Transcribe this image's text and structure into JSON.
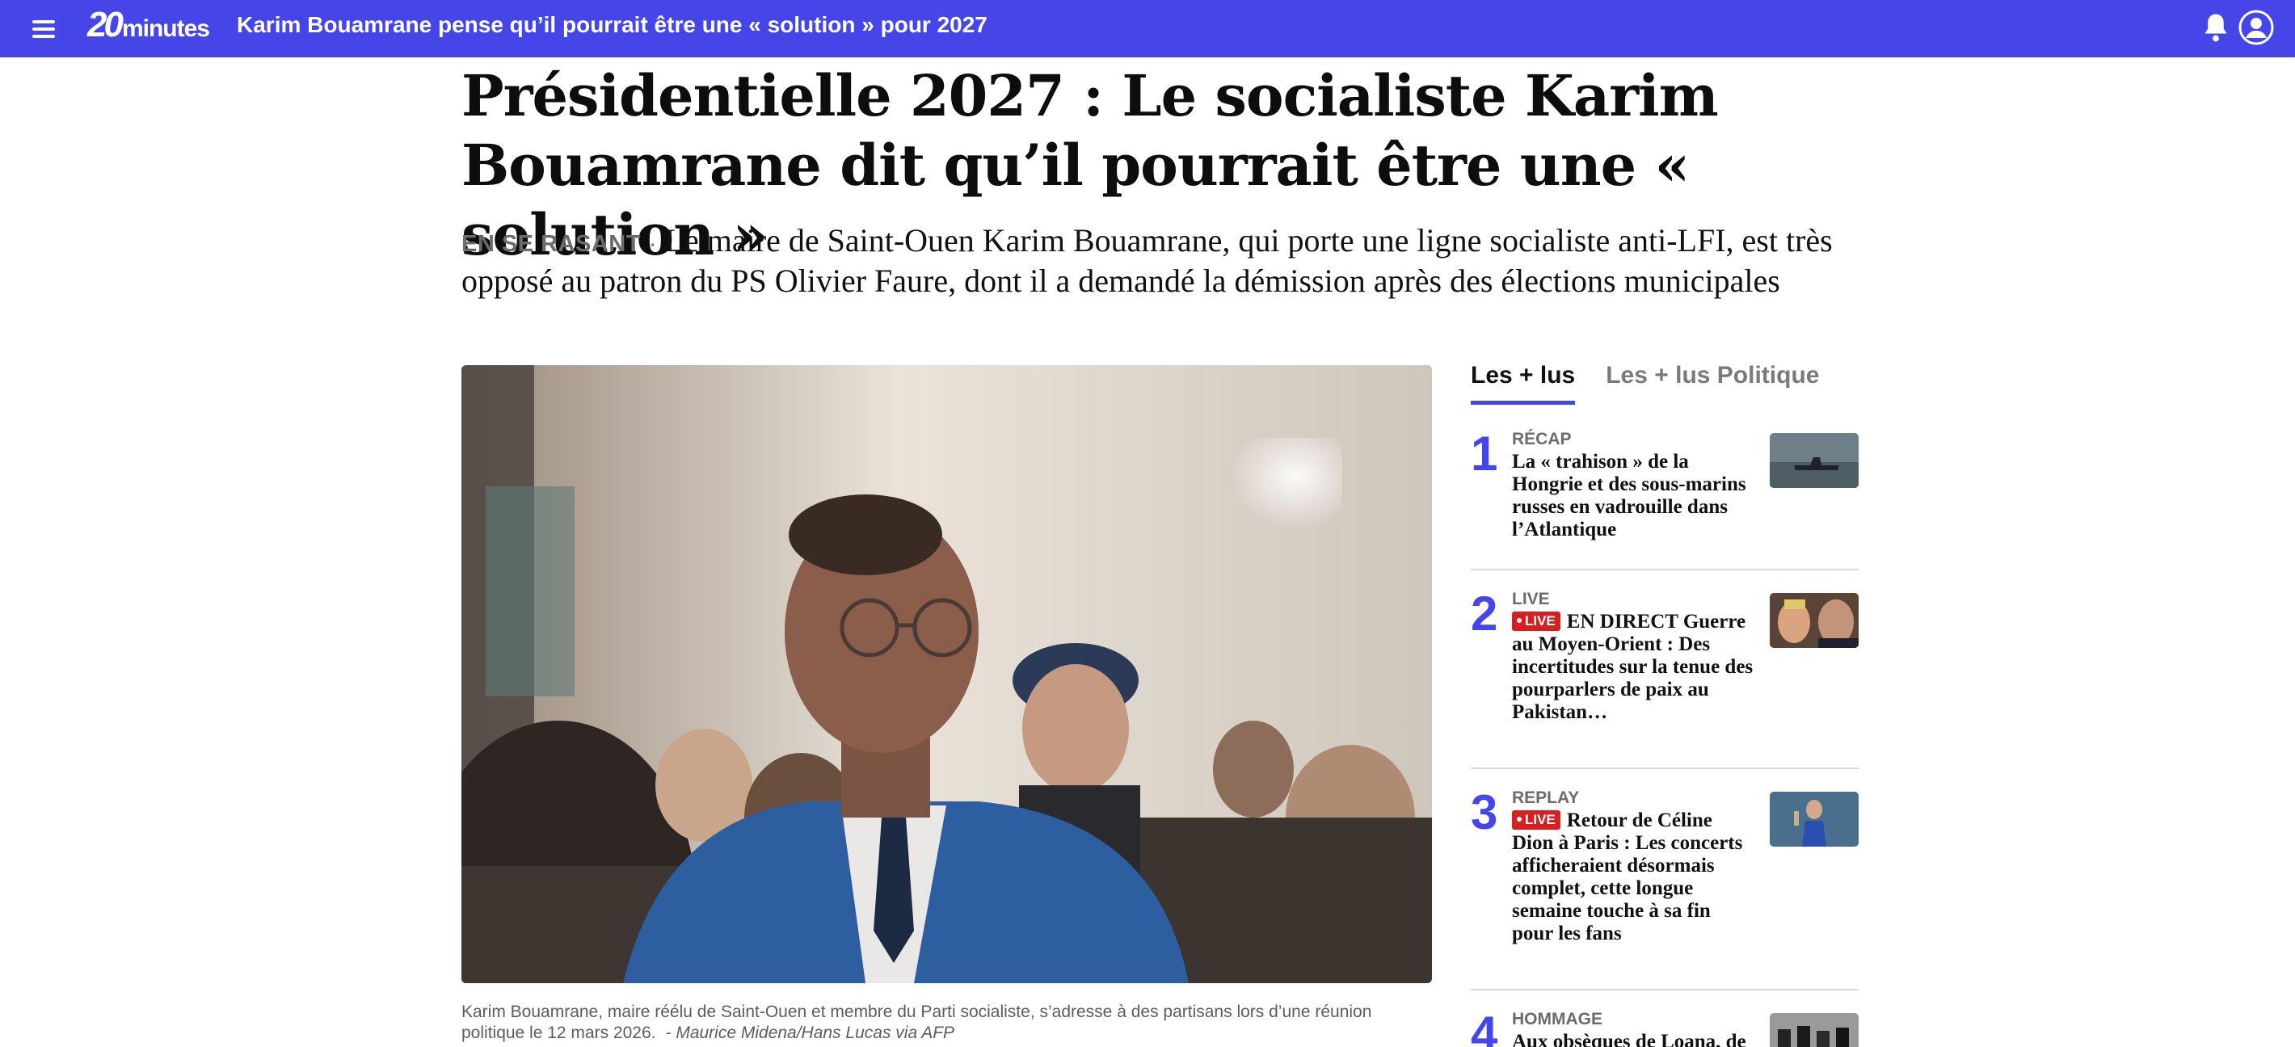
{
  "topbar": {
    "logo_num": "20",
    "logo_word": "minutes",
    "title": "Karim Bouamrane pense qu’il pourrait être une « solution » pour 2027",
    "brand_color": "#4646e8"
  },
  "article": {
    "headline": "Présidentielle 2027 : Le socialiste Karim Bouamrane dit qu’il pourrait être une « solution »",
    "kicker": "EN SE RASANT",
    "kicker_sep": "·",
    "lede": "Le maire de Saint-Ouen Karim Bouamrane, qui porte une ligne socialiste anti-LFI, est très opposé au patron du PS Olivier Faure, dont il a demandé la démission après des élections municipales",
    "caption": "Karim Bouamrane, maire réélu de Saint-Ouen et membre du Parti socialiste, s’adresse à des partisans lors d’une réunion politique le 12 mars 2026.",
    "credit": "- Maurice Midena/Hans Lucas via AFP"
  },
  "sidebar": {
    "tabs": [
      {
        "label": "Les + lus",
        "active": true
      },
      {
        "label": "Les + lus Politique",
        "active": false
      }
    ],
    "items": [
      {
        "rank": "1",
        "category": "RÉCAP",
        "live": false,
        "title": "La « trahison » de la Hongrie et des sous-marins russes en vadrouille dans l’Atlantique",
        "thumb": "submarine-thumbnail"
      },
      {
        "rank": "2",
        "category": "LIVE",
        "live": true,
        "live_label": "LIVE",
        "title": "EN DIRECT Guerre au Moyen-Orient : Des incertitudes sur la tenue des pourparlers de paix au Pakistan…",
        "thumb": "politicians-thumbnail"
      },
      {
        "rank": "3",
        "category": "REPLAY",
        "live": true,
        "live_label": "LIVE",
        "title": "Retour de Céline Dion à Paris : Les concerts afficheraient désormais complet, cette longue semaine touche à sa fin pour les fans",
        "thumb": "singer-thumbnail"
      },
      {
        "rank": "4",
        "category": "HOMMAGE",
        "live": false,
        "title": "Aux obsèques de Loana, de rares personnalités et",
        "thumb": "funeral-thumbnail"
      }
    ]
  }
}
